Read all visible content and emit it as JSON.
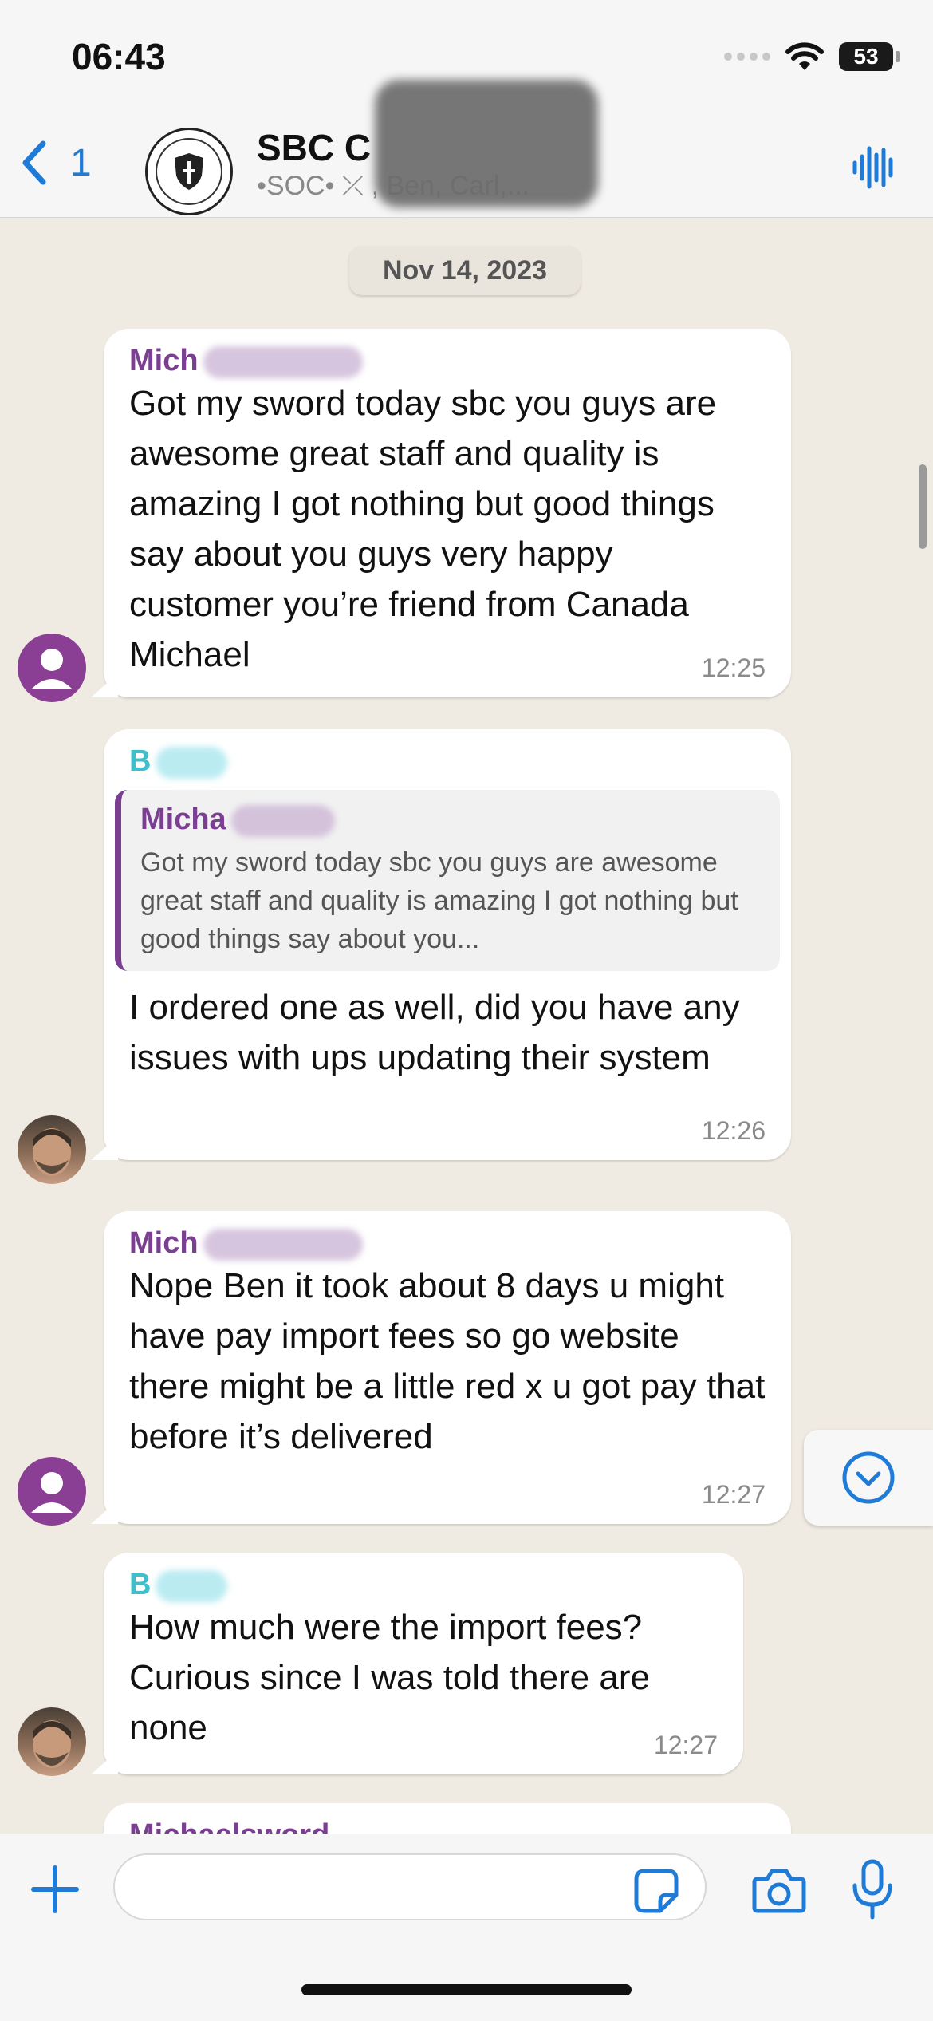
{
  "status_bar": {
    "time": "06:43",
    "battery": "53"
  },
  "header": {
    "back_count": "1",
    "group_name": "SBC C",
    "group_members": "•SOC•  ⤫   , Ben, Carl,..."
  },
  "chat": {
    "date": "Nov 14, 2023",
    "messages": [
      {
        "sender": "Mich",
        "text": "Got my sword today sbc you guys are awesome great staff and quality is amazing I got nothing but good things say about you guys very happy customer you’re friend from Canada Michael",
        "time": "12:25"
      },
      {
        "sender": "B",
        "quote_sender": "Micha",
        "quote_text": "Got my sword today sbc you guys are awesome great staff and quality is amazing I got nothing but good things say about you...",
        "text": "I ordered one as well, did you have any issues with ups updating their system",
        "time": "12:26"
      },
      {
        "sender": "Mich",
        "text": "Nope Ben it took about 8 days u might have pay import fees so go website there might be a little red x u got pay that before it’s delivered",
        "time": "12:27"
      },
      {
        "sender": "B",
        "text": "How much were the import fees? Curious since I was told there are none",
        "time": "12:27"
      },
      {
        "sender": "Michaelsword"
      }
    ]
  },
  "input": {
    "placeholder": ""
  },
  "colors": {
    "accent": "#1f7bd8",
    "purple_sender": "#7b3f91",
    "teal_sender": "#3fbfcc",
    "chat_bg": "#efeae2"
  },
  "icons": [
    "back-chevron-icon",
    "wifi-icon",
    "voice-wave-icon",
    "scroll-down-icon",
    "plus-icon",
    "sticker-icon",
    "camera-icon",
    "microphone-icon"
  ]
}
